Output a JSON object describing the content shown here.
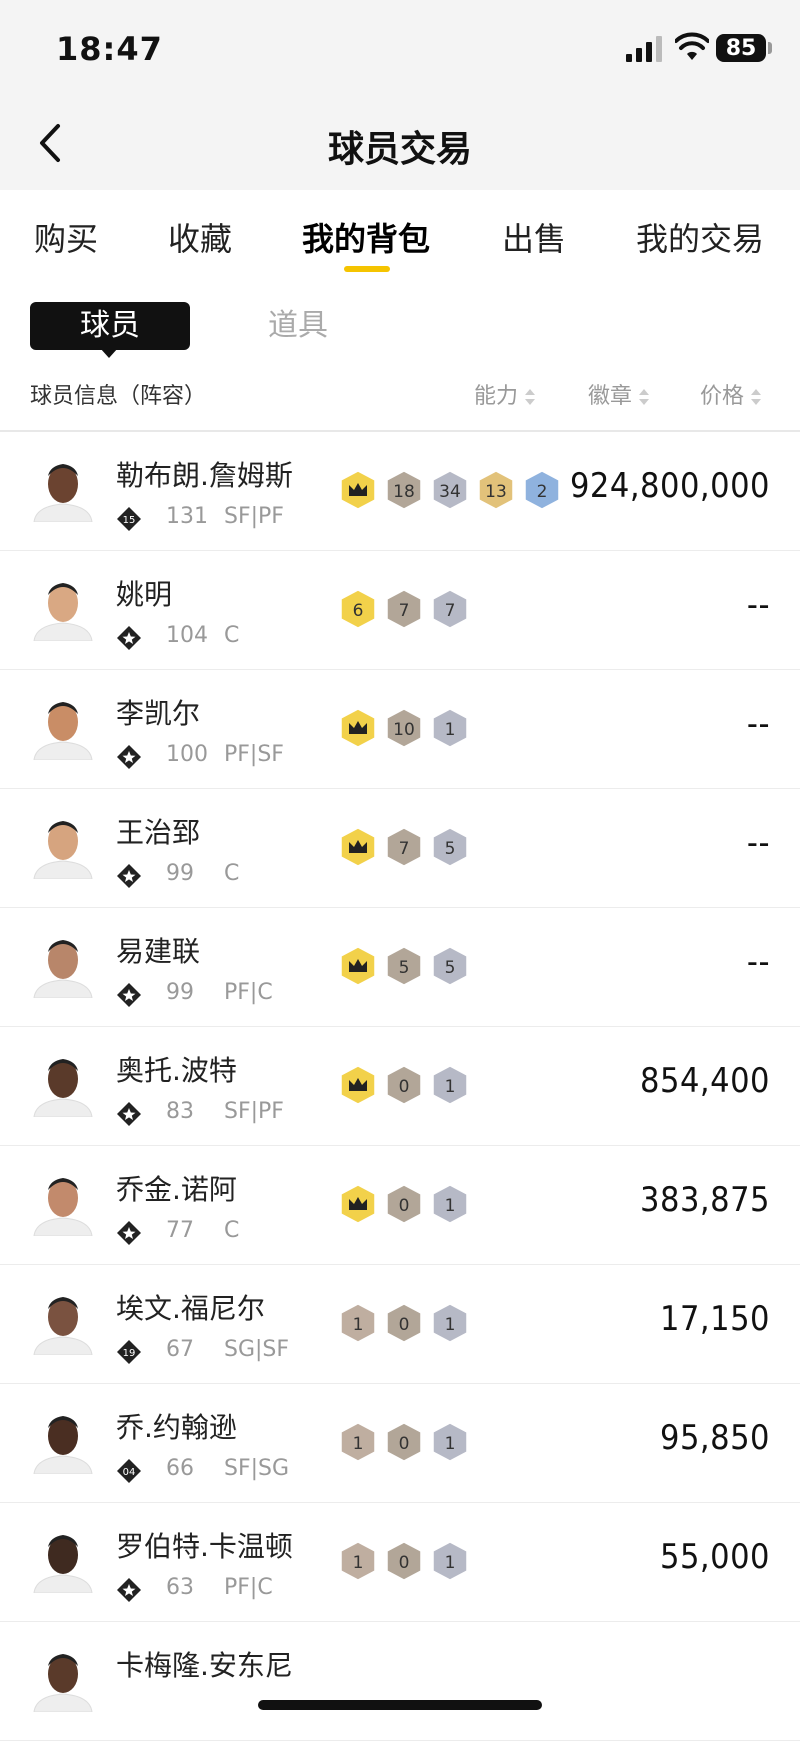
{
  "status": {
    "time": "18:47",
    "battery": "85"
  },
  "nav": {
    "title": "球员交易"
  },
  "tabs": [
    {
      "label": "购买",
      "active": false
    },
    {
      "label": "收藏",
      "active": false
    },
    {
      "label": "我的背包",
      "active": true
    },
    {
      "label": "出售",
      "active": false
    },
    {
      "label": "我的交易",
      "active": false
    }
  ],
  "segments": {
    "players": "球员",
    "items": "道具"
  },
  "header": {
    "info": "球员信息（阵容）",
    "ability": "能力",
    "badge": "徽章",
    "price": "价格"
  },
  "players": [
    {
      "name": "勒布朗.詹姆斯",
      "tier": "15",
      "ovr": "131",
      "pos": "SF|PF",
      "price": "924,800,000",
      "badges": [
        {
          "t": "crown",
          "c": "#f2d14a"
        },
        {
          "t": "18",
          "c": "#b2a698"
        },
        {
          "t": "34",
          "c": "#b6b9c6"
        },
        {
          "t": "13",
          "c": "#e2c27a"
        },
        {
          "t": "2",
          "c": "#8fb2de"
        }
      ]
    },
    {
      "name": "姚明",
      "tier": "",
      "ovr": "104",
      "pos": "C",
      "price": "--",
      "badges": [
        {
          "t": "6",
          "c": "#f2d14a"
        },
        {
          "t": "7",
          "c": "#b2a698"
        },
        {
          "t": "7",
          "c": "#b6b9c6"
        }
      ]
    },
    {
      "name": "李凯尔",
      "tier": "",
      "ovr": "100",
      "pos": "PF|SF",
      "price": "--",
      "badges": [
        {
          "t": "crown",
          "c": "#f2d14a"
        },
        {
          "t": "10",
          "c": "#b2a698"
        },
        {
          "t": "1",
          "c": "#b6b9c6"
        }
      ]
    },
    {
      "name": "王治郅",
      "tier": "",
      "ovr": "99",
      "pos": "C",
      "price": "--",
      "badges": [
        {
          "t": "crown",
          "c": "#f2d14a"
        },
        {
          "t": "7",
          "c": "#b2a698"
        },
        {
          "t": "5",
          "c": "#b6b9c6"
        }
      ]
    },
    {
      "name": "易建联",
      "tier": "",
      "ovr": "99",
      "pos": "PF|C",
      "price": "--",
      "badges": [
        {
          "t": "crown",
          "c": "#f2d14a"
        },
        {
          "t": "5",
          "c": "#b2a698"
        },
        {
          "t": "5",
          "c": "#b6b9c6"
        }
      ]
    },
    {
      "name": "奥托.波特",
      "tier": "",
      "ovr": "83",
      "pos": "SF|PF",
      "price": "854,400",
      "badges": [
        {
          "t": "crown",
          "c": "#f2d14a"
        },
        {
          "t": "0",
          "c": "#b2a698"
        },
        {
          "t": "1",
          "c": "#b6b9c6"
        }
      ]
    },
    {
      "name": "乔金.诺阿",
      "tier": "",
      "ovr": "77",
      "pos": "C",
      "price": "383,875",
      "badges": [
        {
          "t": "crown",
          "c": "#f2d14a"
        },
        {
          "t": "0",
          "c": "#b2a698"
        },
        {
          "t": "1",
          "c": "#b6b9c6"
        }
      ]
    },
    {
      "name": "埃文.福尼尔",
      "tier": "19",
      "ovr": "67",
      "pos": "SG|SF",
      "price": "17,150",
      "badges": [
        {
          "t": "1",
          "c": "#bfaea0"
        },
        {
          "t": "0",
          "c": "#b2a698"
        },
        {
          "t": "1",
          "c": "#b6b9c6"
        }
      ]
    },
    {
      "name": "乔.约翰逊",
      "tier": "04",
      "ovr": "66",
      "pos": "SF|SG",
      "price": "95,850",
      "badges": [
        {
          "t": "1",
          "c": "#bfaea0"
        },
        {
          "t": "0",
          "c": "#b2a698"
        },
        {
          "t": "1",
          "c": "#b6b9c6"
        }
      ]
    },
    {
      "name": "罗伯特.卡温顿",
      "tier": "",
      "ovr": "63",
      "pos": "PF|C",
      "price": "55,000",
      "badges": [
        {
          "t": "1",
          "c": "#bfaea0"
        },
        {
          "t": "0",
          "c": "#b2a698"
        },
        {
          "t": "1",
          "c": "#b6b9c6"
        }
      ]
    },
    {
      "name": "卡梅隆.安东尼",
      "tier": "",
      "ovr": "",
      "pos": "",
      "price": "",
      "badges": []
    }
  ]
}
